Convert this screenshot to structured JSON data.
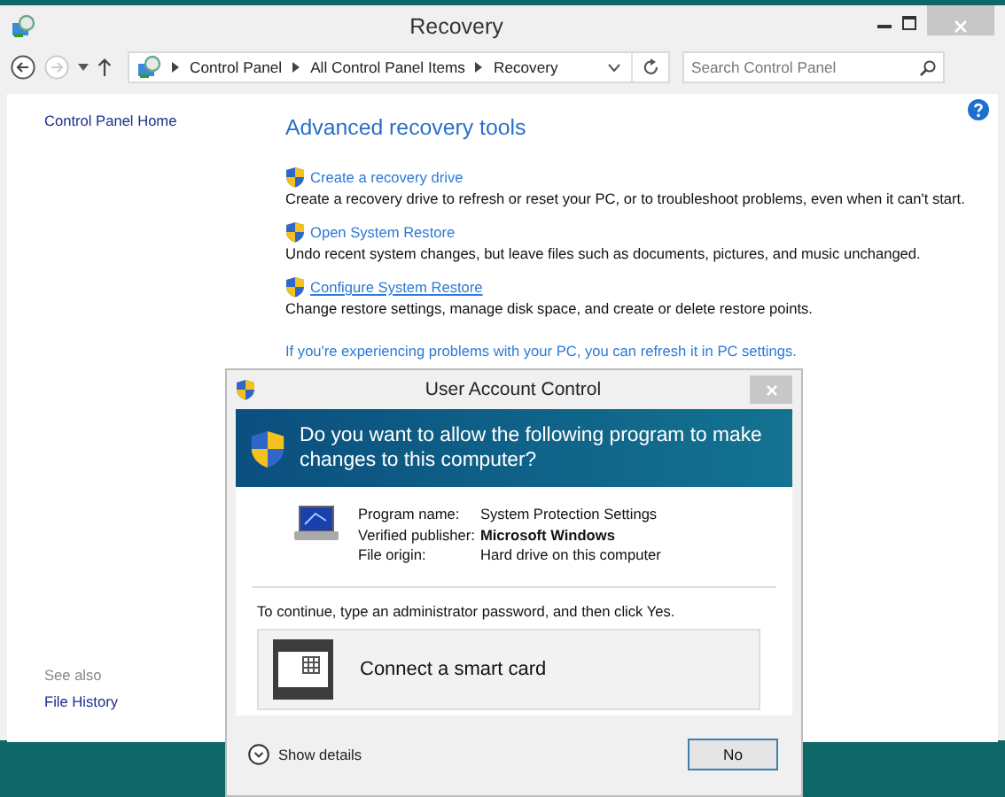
{
  "window": {
    "title": "Recovery"
  },
  "nav": {
    "breadcrumbs": [
      "Control Panel",
      "All Control Panel Items",
      "Recovery"
    ],
    "search": {
      "placeholder": "Search Control Panel"
    }
  },
  "sidebar": {
    "home_link": "Control Panel Home",
    "see_also": {
      "heading": "See also",
      "links": [
        "File History"
      ]
    }
  },
  "main": {
    "heading": "Advanced recovery tools",
    "tasks": [
      {
        "link": "Create a recovery drive",
        "description": "Create a recovery drive to refresh or reset your PC, or to troubleshoot problems, even when it can't start.",
        "hovered": false
      },
      {
        "link": "Open System Restore",
        "description": "Undo recent system changes, but leave files such as documents, pictures, and music unchanged.",
        "hovered": false
      },
      {
        "link": "Configure System Restore",
        "description": "Change restore settings, manage disk space, and create or delete restore points.",
        "hovered": true
      }
    ],
    "refresh_link": "If you're experiencing problems with your PC, you can refresh it in PC settings."
  },
  "uac": {
    "title": "User Account Control",
    "question": "Do you want to allow the following program to make changes to this computer?",
    "details": [
      {
        "label": "Program name:",
        "value": "System Protection Settings",
        "bold": false
      },
      {
        "label": "Verified publisher:",
        "value": "Microsoft Windows",
        "bold": true
      },
      {
        "label": "File origin:",
        "value": "Hard drive on this computer",
        "bold": false
      }
    ],
    "instruction": "To continue, type an administrator password, and then click Yes.",
    "smart_card": "Connect a smart card",
    "show_details": "Show details",
    "button": "No"
  }
}
